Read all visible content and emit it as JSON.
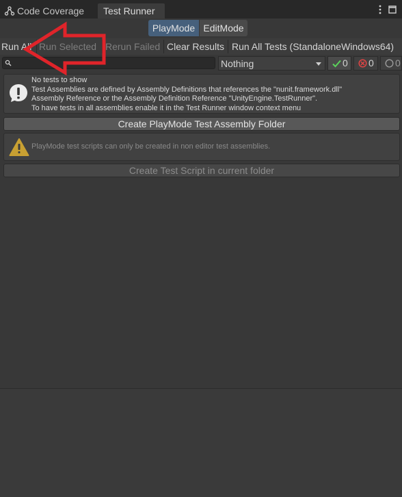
{
  "tabs": [
    {
      "label": "Code Coverage",
      "icon": "code-coverage-icon"
    },
    {
      "label": "Test Runner"
    }
  ],
  "window_menu": {
    "more_icon": "vertical-ellipsis-icon",
    "maximize_icon": "maximize-icon"
  },
  "mode_switch": {
    "playmode": "PlayMode",
    "editmode": "EditMode",
    "active": "PlayMode"
  },
  "toolbar": {
    "run_all": "Run All",
    "run_selected": "Run Selected",
    "rerun_failed": "Rerun Failed",
    "clear_results": "Clear Results",
    "run_all_tests": "Run All Tests (StandaloneWindows64)"
  },
  "filter": {
    "search_placeholder": "",
    "dropdown_value": "Nothing",
    "passed_count": "0",
    "failed_count": "0",
    "skipped_count": "0"
  },
  "info_message": {
    "lines": [
      "No tests to show",
      "Test Assemblies are defined by Assembly Definitions that references the \"nunit.framework.dll\"",
      "Assembly Reference or the Assembly Definition Reference \"UnityEngine.TestRunner\".",
      "To have tests in all assemblies enable it in the Test Runner window context menu"
    ]
  },
  "create_folder_button": "Create PlayMode Test Assembly Folder",
  "warning_message": "PlayMode test scripts can only be created in non editor test assemblies.",
  "create_script_button": "Create Test Script in current folder",
  "colors": {
    "background": "#383838",
    "active_mode": "#46607c",
    "annotation_arrow": "#e0242a",
    "pass": "#5bd35b",
    "fail": "#e04444",
    "warning": "#c8a032"
  }
}
